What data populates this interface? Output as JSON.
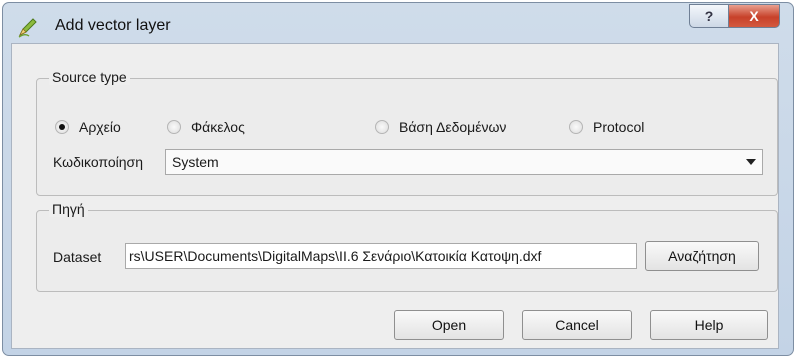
{
  "window": {
    "title": "Add vector layer",
    "help_glyph": "?",
    "close_glyph": "X"
  },
  "source_type": {
    "title": "Source type",
    "options": [
      "Αρχείο",
      "Φάκελος",
      "Βάση Δεδομένων",
      "Protocol"
    ],
    "selected": "Αρχείο",
    "encoding_label": "Κωδικοποίηση",
    "encoding_value": "System"
  },
  "source": {
    "title": "Πηγή",
    "dataset_label": "Dataset",
    "dataset_value": "rs\\USER\\Documents\\DigitalMaps\\II.6 Σενάριο\\Κατοικία Κατοψη.dxf",
    "browse_label": "Αναζήτηση"
  },
  "buttons": {
    "open": "Open",
    "cancel": "Cancel",
    "help": "Help"
  },
  "icons": {
    "window_icon": "vector-layer-pen-icon"
  }
}
